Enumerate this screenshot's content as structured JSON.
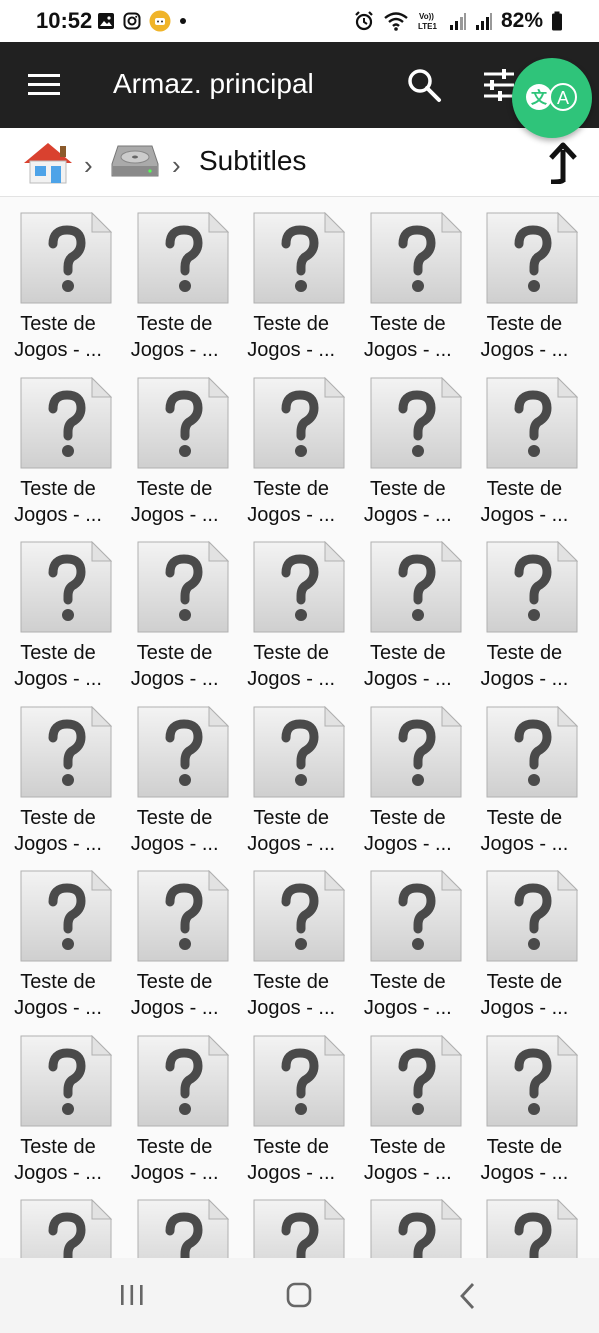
{
  "status_bar": {
    "time": "10:52",
    "battery": "82%"
  },
  "app_bar": {
    "title": "Armaz. principal"
  },
  "breadcrumb": {
    "current_folder": "Subtitles"
  },
  "file_label_line1": "Teste de",
  "file_label_line2": "Jogos - ...",
  "grid": {
    "columns": 5,
    "visible_rows": 7
  },
  "colors": {
    "app_bar_bg": "#212121",
    "translate_button": "#2fc47a",
    "background": "#fafafa"
  }
}
